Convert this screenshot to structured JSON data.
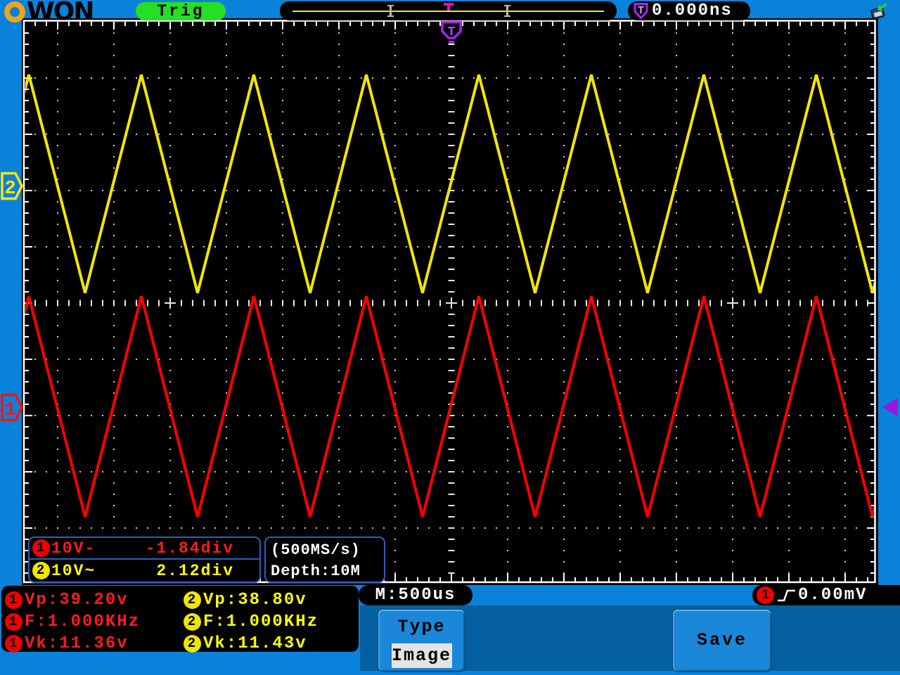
{
  "topbar": {
    "logo_letters": "WON",
    "trig_label": "Trig",
    "ruler_trigger_marker": "T",
    "trigger_badge": "T",
    "trigger_time": "0.000ns"
  },
  "display": {
    "trigger_position_badge": "T",
    "ch2_tag": "2",
    "ch1_tag": "1",
    "channel_info": [
      {
        "badge": "1",
        "scale": "10V-",
        "offset": "-1.84div"
      },
      {
        "badge": "2",
        "scale": "10V~",
        "offset": "2.12div"
      }
    ],
    "sample_rate": "(500MS/s)",
    "record_depth": "Depth:10M"
  },
  "measurements": [
    {
      "badge": "1",
      "label": "Vp:39.20v"
    },
    {
      "badge": "2",
      "label": "Vp:38.80v"
    },
    {
      "badge": "1",
      "label": "F:1.000KHz"
    },
    {
      "badge": "2",
      "label": "F:1.000KHz"
    },
    {
      "badge": "1",
      "label": "Vk:11.36v"
    },
    {
      "badge": "2",
      "label": "Vk:11.43v"
    }
  ],
  "bottom": {
    "timebase": "M:500us",
    "menu": {
      "type_title": "Type",
      "type_value": "Image",
      "save_label": "Save"
    },
    "trigger_level": {
      "badge": "1",
      "value": "0.00mV"
    }
  },
  "chart_data": {
    "type": "line",
    "title": "",
    "x_divisions": 15,
    "y_divisions": 10,
    "timebase_per_div": "500us",
    "grid": "dotted",
    "series": [
      {
        "name": "CH1",
        "color": "#ff0000",
        "shape": "triangle",
        "volts_per_div": "10V",
        "period_div": 2,
        "peak_to_peak_div": 3.92,
        "vertical_offset_div": -1.84,
        "first_peak_at_div": 0.0625,
        "vp": "39.20v",
        "freq": "1.000KHz",
        "vk": "11.36v"
      },
      {
        "name": "CH2",
        "color": "#f2e600",
        "shape": "triangle",
        "volts_per_div": "10V",
        "period_div": 2,
        "peak_to_peak_div": 3.88,
        "vertical_offset_div": 2.12,
        "first_peak_at_div": 0.0625,
        "vp": "38.80v",
        "freq": "1.000KHz",
        "vk": "11.43v"
      }
    ]
  }
}
